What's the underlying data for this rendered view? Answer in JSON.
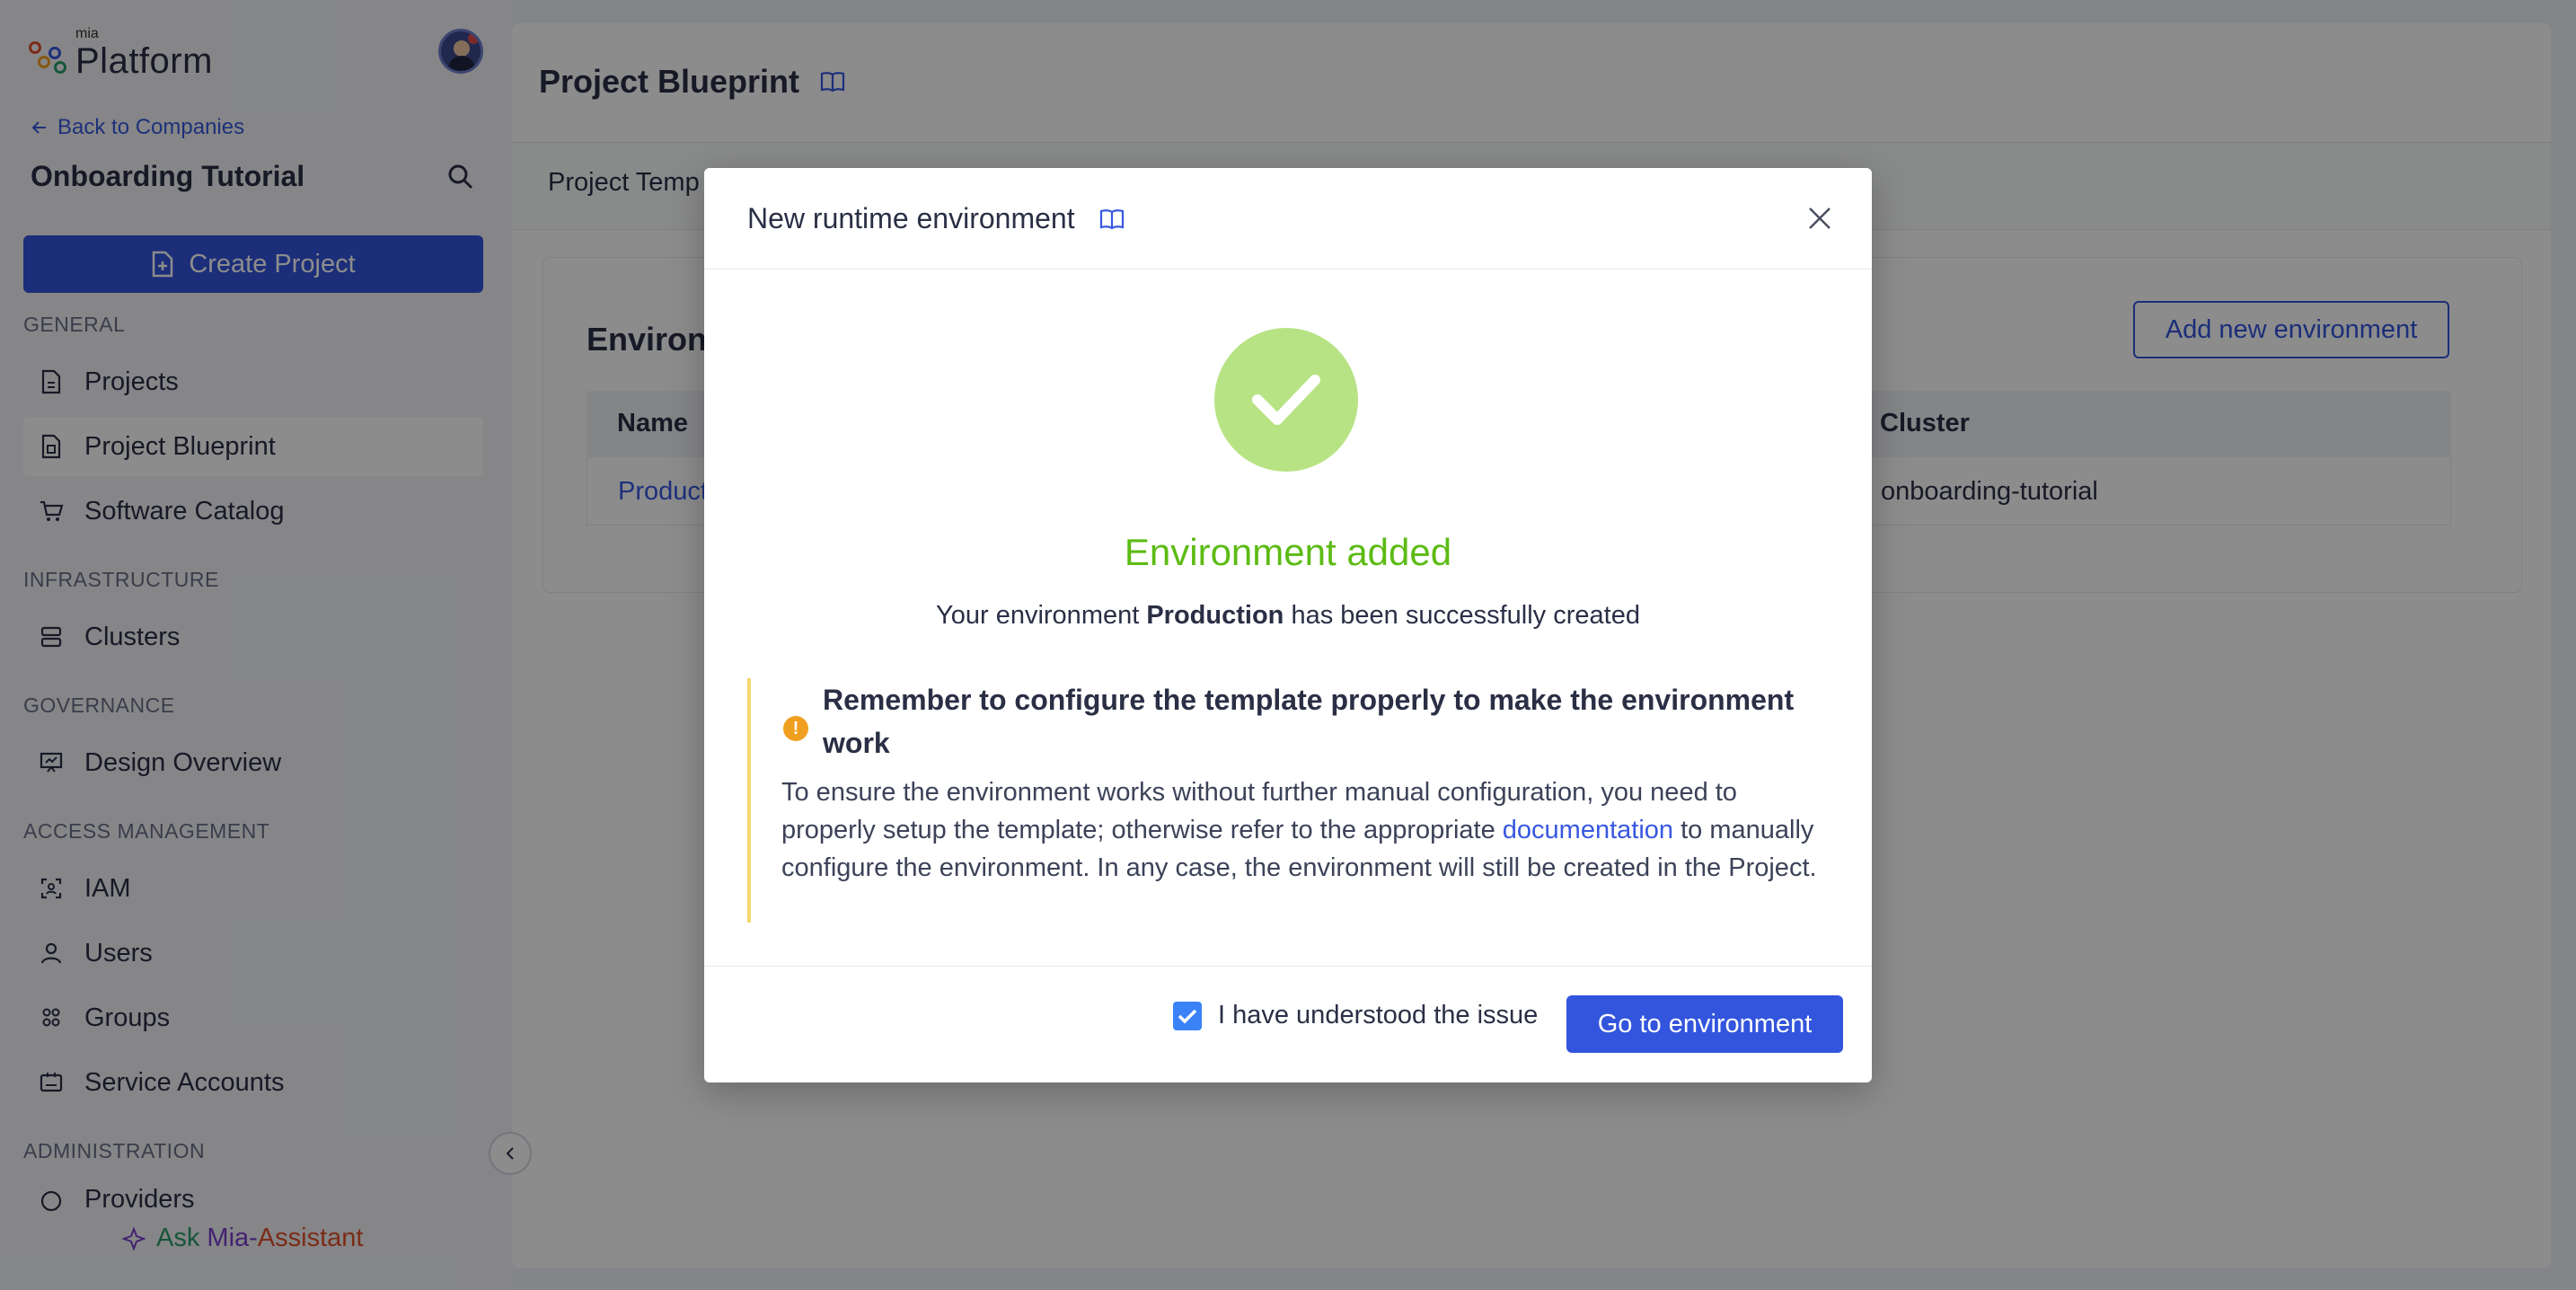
{
  "sidebar": {
    "logo_small": "mia",
    "logo_big": "Platform",
    "back_link": "Back to Companies",
    "company": "Onboarding Tutorial",
    "create_project": "Create Project",
    "sections": {
      "general": "GENERAL",
      "infrastructure": "INFRASTRUCTURE",
      "governance": "GOVERNANCE",
      "access": "ACCESS MANAGEMENT",
      "administration": "ADMINISTRATION"
    },
    "items": [
      {
        "label": "Projects",
        "icon": "document-icon"
      },
      {
        "label": "Project Blueprint",
        "icon": "blueprint-icon"
      },
      {
        "label": "Software Catalog",
        "icon": "cart-icon"
      },
      {
        "label": "Clusters",
        "icon": "server-icon"
      },
      {
        "label": "Design Overview",
        "icon": "presentation-icon"
      },
      {
        "label": "IAM",
        "icon": "identity-icon"
      },
      {
        "label": "Users",
        "icon": "user-icon"
      },
      {
        "label": "Groups",
        "icon": "group-icon"
      },
      {
        "label": "Service Accounts",
        "icon": "id-card-icon"
      },
      {
        "label": "Providers",
        "icon": "providers-icon"
      }
    ],
    "assistant": {
      "a1": "Ask",
      "a2": "Mia-",
      "a3": "Assistant"
    }
  },
  "main": {
    "title": "Project Blueprint",
    "tab": "Project Temp",
    "card_title": "Environ",
    "add_button": "Add new environment",
    "table": {
      "headers": {
        "name": "Name",
        "cluster": "Cluster"
      },
      "rows": [
        {
          "name": "Product",
          "cluster": "onboarding-tutorial"
        }
      ]
    }
  },
  "modal": {
    "title": "New runtime environment",
    "success_title": "Environment added",
    "success_prefix": "Your environment ",
    "env_name": "Production",
    "success_suffix": " has been successfully created",
    "warning_title": "Remember to configure the template properly to make the environment work",
    "warning_body_1": "To ensure the environment works without further manual configuration, you need to properly setup the template; otherwise refer to the appropriate ",
    "warning_link": "documentation",
    "warning_body_2": " to manually configure the environment. In any case, the environment will still be created in the Project.",
    "checkbox_label": "I have understood the issue",
    "checkbox_checked": true,
    "go_button": "Go to environment"
  },
  "colors": {
    "primary": "#3355dd",
    "success": "#5cbb14",
    "warning": "#f0a020"
  }
}
